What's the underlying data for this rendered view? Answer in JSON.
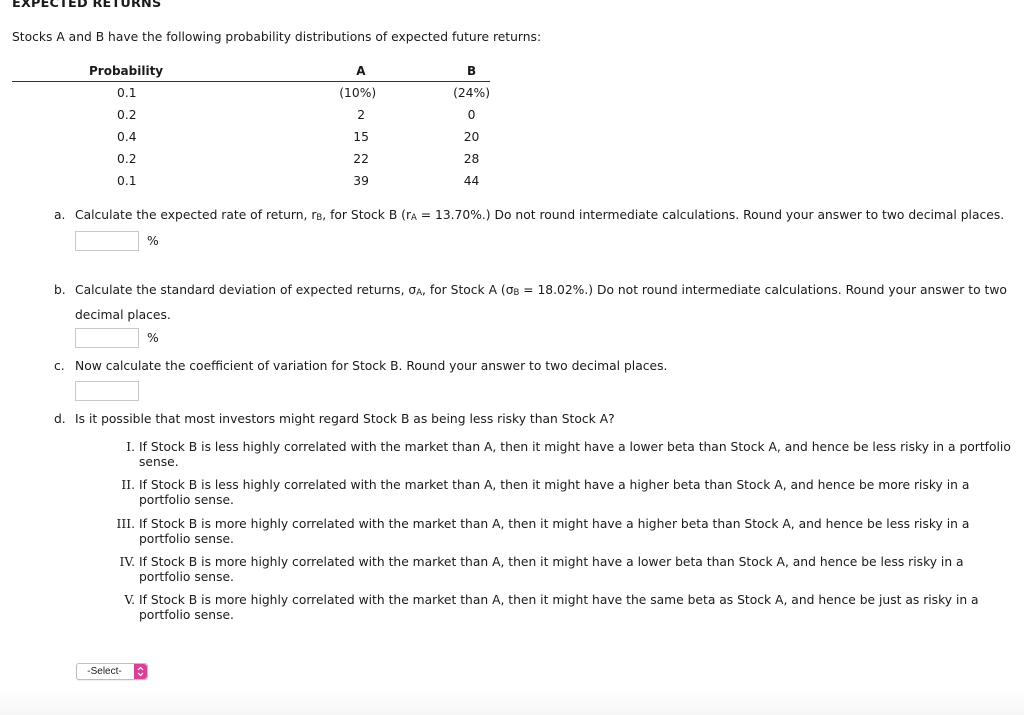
{
  "title": "EXPECTED RETURNS",
  "intro": "Stocks A and B have the following probability distributions of expected future returns:",
  "table": {
    "headers": [
      "Probability",
      "A",
      "B"
    ],
    "rows": [
      [
        "0.1",
        "(10%)",
        "(24%)"
      ],
      [
        "0.2",
        "2",
        "0"
      ],
      [
        "0.4",
        "15",
        "20"
      ],
      [
        "0.2",
        "22",
        "28"
      ],
      [
        "0.1",
        "39",
        "44"
      ]
    ]
  },
  "questions": {
    "a": {
      "label": "a.",
      "text_1": "Calculate the expected rate of return, r",
      "sub_1": "B",
      "text_2": ", for Stock B (r",
      "sub_2": "A",
      "text_3": " = 13.70%.) Do not round intermediate calculations. Round your answer to two decimal places.",
      "input_value": "",
      "unit": "%"
    },
    "b": {
      "label": "b.",
      "text_1": "Calculate the standard deviation of expected returns, σ",
      "sub_1": "A",
      "text_2": ", for Stock A (σ",
      "sub_2": "B",
      "text_3": " = 18.02%.) Do not round intermediate calculations. Round your answer to two decimal places.",
      "input_value": "",
      "unit": "%"
    },
    "c": {
      "label": "c.",
      "text": "Now calculate the coefficient of variation for Stock B. Round your answer to two decimal places.",
      "input_value": ""
    },
    "d": {
      "label": "d.",
      "text": "Is it possible that most investors might regard Stock B as being less risky than Stock A?",
      "choices": [
        {
          "num": "I.",
          "text": "If Stock B is less highly correlated with the market than A, then it might have a lower beta than Stock A, and hence be less risky in a portfolio sense."
        },
        {
          "num": "II.",
          "text": "If Stock B is less highly correlated with the market than A, then it might have a higher beta than Stock A, and hence be more risky in a portfolio sense."
        },
        {
          "num": "III.",
          "text": "If Stock B is more highly correlated with the market than A, then it might have a higher beta than Stock A, and hence be less risky in a portfolio sense."
        },
        {
          "num": "IV.",
          "text": "If Stock B is more highly correlated with the market than A, then it might have a lower beta than Stock A, and hence be less risky in a portfolio sense."
        },
        {
          "num": "V.",
          "text": "If Stock B is more highly correlated with the market than A, then it might have the same beta as Stock A, and hence be just as risky in a portfolio sense."
        }
      ],
      "select_value": "-Select-"
    }
  },
  "colors": {
    "select_accent": "#d8419a"
  }
}
